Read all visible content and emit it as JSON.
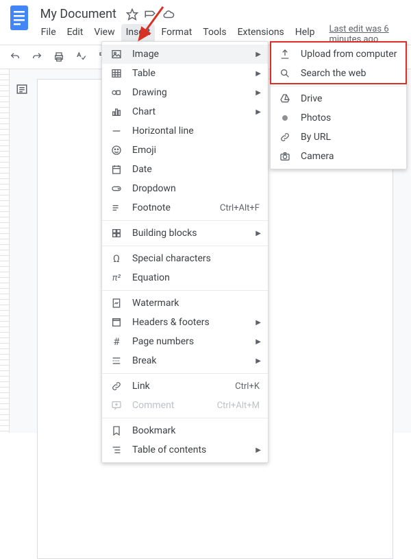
{
  "header": {
    "title": "My Document",
    "last_edit": "Last edit was 6 minutes ago"
  },
  "menubar": {
    "file": "File",
    "edit": "Edit",
    "view": "View",
    "insert": "Insert",
    "format": "Format",
    "tools": "Tools",
    "extensions": "Extensions",
    "help": "Help"
  },
  "insert_menu": {
    "image": "Image",
    "table": "Table",
    "drawing": "Drawing",
    "chart": "Chart",
    "horizontal_line": "Horizontal line",
    "emoji": "Emoji",
    "date": "Date",
    "dropdown": "Dropdown",
    "footnote": "Footnote",
    "footnote_shortcut": "Ctrl+Alt+F",
    "building_blocks": "Building blocks",
    "special_characters": "Special characters",
    "equation": "Equation",
    "watermark": "Watermark",
    "headers_footers": "Headers & footers",
    "page_numbers": "Page numbers",
    "break": "Break",
    "link": "Link",
    "link_shortcut": "Ctrl+K",
    "comment": "Comment",
    "comment_shortcut": "Ctrl+Alt+M",
    "bookmark": "Bookmark",
    "table_of_contents": "Table of contents"
  },
  "image_submenu": {
    "upload": "Upload from computer",
    "search_web": "Search the web",
    "drive": "Drive",
    "photos": "Photos",
    "by_url": "By URL",
    "camera": "Camera"
  }
}
